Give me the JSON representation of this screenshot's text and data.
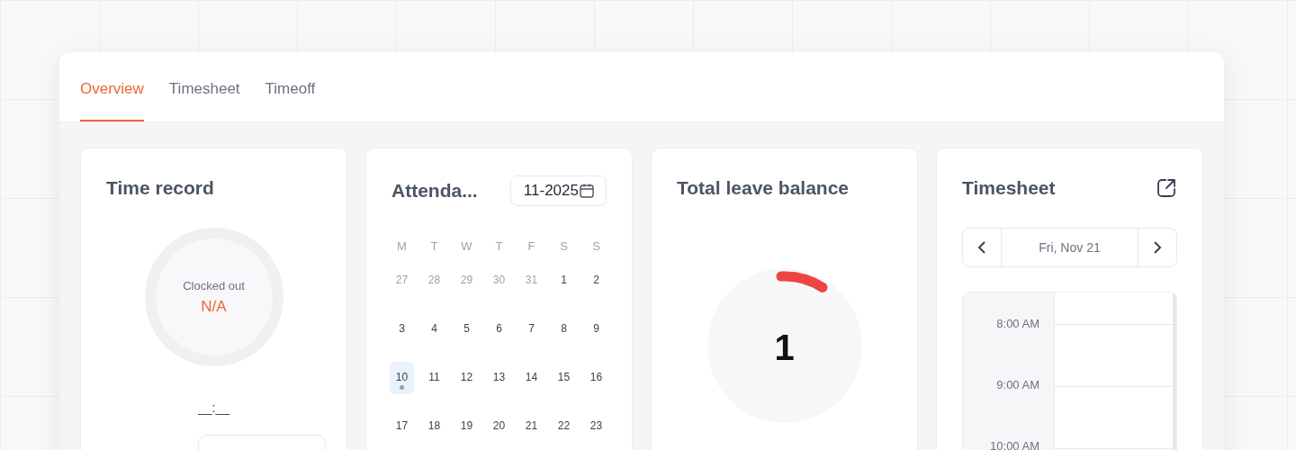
{
  "tabs": [
    {
      "label": "Overview",
      "selected": true
    },
    {
      "label": "Timesheet",
      "selected": false
    },
    {
      "label": "Timeoff",
      "selected": false
    }
  ],
  "time_record": {
    "title": "Time record",
    "status": "Clocked out",
    "value": "N/A",
    "time": "__:__"
  },
  "attendance": {
    "title": "Attenda...",
    "month": "11-2025",
    "weekdays": [
      "M",
      "T",
      "W",
      "T",
      "F",
      "S",
      "S"
    ],
    "weeks": [
      [
        {
          "day": "27",
          "outside": true,
          "selected": false,
          "has_entry": false
        },
        {
          "day": "28",
          "outside": true,
          "selected": false,
          "has_entry": false
        },
        {
          "day": "29",
          "outside": true,
          "selected": false,
          "has_entry": false
        },
        {
          "day": "30",
          "outside": true,
          "selected": false,
          "has_entry": false
        },
        {
          "day": "31",
          "outside": true,
          "selected": false,
          "has_entry": false
        },
        {
          "day": "1",
          "outside": false,
          "selected": false,
          "has_entry": false
        },
        {
          "day": "2",
          "outside": false,
          "selected": false,
          "has_entry": false
        }
      ],
      [
        {
          "day": "3",
          "outside": false,
          "selected": false,
          "has_entry": false
        },
        {
          "day": "4",
          "outside": false,
          "selected": false,
          "has_entry": false
        },
        {
          "day": "5",
          "outside": false,
          "selected": false,
          "has_entry": false
        },
        {
          "day": "6",
          "outside": false,
          "selected": false,
          "has_entry": false
        },
        {
          "day": "7",
          "outside": false,
          "selected": false,
          "has_entry": false
        },
        {
          "day": "8",
          "outside": false,
          "selected": false,
          "has_entry": false
        },
        {
          "day": "9",
          "outside": false,
          "selected": false,
          "has_entry": false
        }
      ],
      [
        {
          "day": "10",
          "outside": false,
          "selected": true,
          "has_entry": true
        },
        {
          "day": "11",
          "outside": false,
          "selected": false,
          "has_entry": false
        },
        {
          "day": "12",
          "outside": false,
          "selected": false,
          "has_entry": false
        },
        {
          "day": "13",
          "outside": false,
          "selected": false,
          "has_entry": false
        },
        {
          "day": "14",
          "outside": false,
          "selected": false,
          "has_entry": false
        },
        {
          "day": "15",
          "outside": false,
          "selected": false,
          "has_entry": false
        },
        {
          "day": "16",
          "outside": false,
          "selected": false,
          "has_entry": false
        }
      ],
      [
        {
          "day": "17",
          "outside": false,
          "selected": false,
          "has_entry": false
        },
        {
          "day": "18",
          "outside": false,
          "selected": false,
          "has_entry": false
        },
        {
          "day": "19",
          "outside": false,
          "selected": false,
          "has_entry": false
        },
        {
          "day": "20",
          "outside": false,
          "selected": false,
          "has_entry": false
        },
        {
          "day": "21",
          "outside": false,
          "selected": false,
          "has_entry": false
        },
        {
          "day": "22",
          "outside": false,
          "selected": false,
          "has_entry": false
        },
        {
          "day": "23",
          "outside": false,
          "selected": false,
          "has_entry": false
        }
      ]
    ]
  },
  "leave_balance": {
    "title": "Total leave balance",
    "value": "1",
    "level": 0.1
  },
  "timesheet": {
    "title": "Timesheet",
    "date": "Fri, Nov 21",
    "hours": [
      "8:00 AM",
      "9:00 AM",
      "10:00 AM"
    ]
  }
}
